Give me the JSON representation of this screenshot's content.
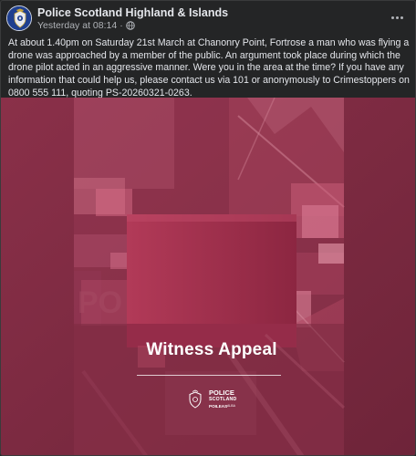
{
  "post": {
    "page_name": "Police Scotland Highland & Islands",
    "timestamp": "Yesterday at 08:14",
    "separator": "·",
    "privacy_icon": "globe-icon",
    "more_icon": "more-options-icon",
    "body": "At about 1.40pm on Saturday 21st March at Chanonry Point, Fortrose a man who was flying a drone was approached by a member of the public. An argument took place during which the drone pilot acted in an aggressive manner. Were you in the area at the time? If you have any information that could help us, please contact us via 101 or anonymously to Crimestoppers on 0800 555 111, quoting PS-20260321-0263."
  },
  "image": {
    "title": "Witness Appeal",
    "logo_police": "POLICE",
    "logo_scotland": "SCOTLAND",
    "logo_gaelic": "POILEAS",
    "logo_small": "ALBA",
    "background_letters": "PO",
    "colors": {
      "base": "#7d2a42",
      "card": "#a52848",
      "highlight": "#e0738f"
    }
  }
}
